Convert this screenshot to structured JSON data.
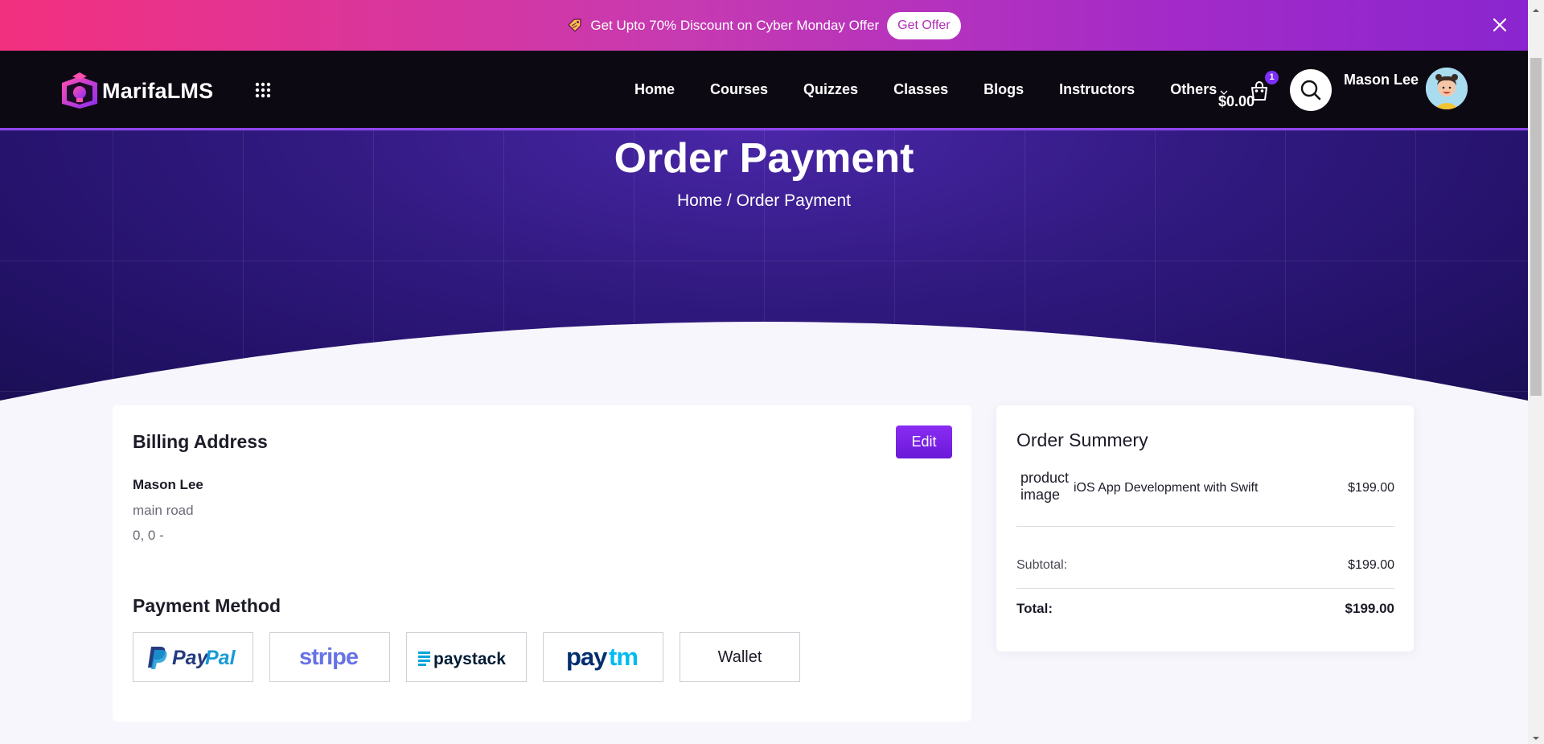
{
  "promo": {
    "text": "Get Upto 70% Discount on Cyber Monday Offer",
    "button": "Get Offer"
  },
  "header": {
    "logo_text": "MarifaLMS",
    "nav": [
      "Home",
      "Courses",
      "Quizzes",
      "Classes",
      "Blogs",
      "Instructors",
      "Others"
    ],
    "cart_count": "1",
    "user_name": "Mason Lee",
    "user_balance": "$0.00"
  },
  "hero": {
    "title": "Order Payment",
    "breadcrumb_home": "Home",
    "breadcrumb_sep": "/",
    "breadcrumb_current": "Order Payment"
  },
  "billing": {
    "title": "Billing Address",
    "edit": "Edit",
    "name": "Mason Lee",
    "line1": "main road",
    "line2": "0, 0 -"
  },
  "payment": {
    "title": "Payment Method",
    "methods": [
      "PayPal",
      "stripe",
      "paystack",
      "paytm",
      "Wallet"
    ]
  },
  "summary": {
    "title": "Order Summery",
    "product_image_alt": "product image",
    "product_name": "iOS App Development with Swift",
    "product_price": "$199.00",
    "subtotal_label": "Subtotal:",
    "subtotal_value": "$199.00",
    "total_label": "Total:",
    "total_value": "$199.00"
  },
  "colors": {
    "accent": "#7b2ff7",
    "paypal_dark": "#253b80",
    "paypal_light": "#179bd7",
    "stripe": "#6772e5",
    "paystack": "#011b33",
    "paystack_bars": "#09a5db",
    "paytm_dark": "#042e6f",
    "paytm_light": "#00baf2"
  }
}
